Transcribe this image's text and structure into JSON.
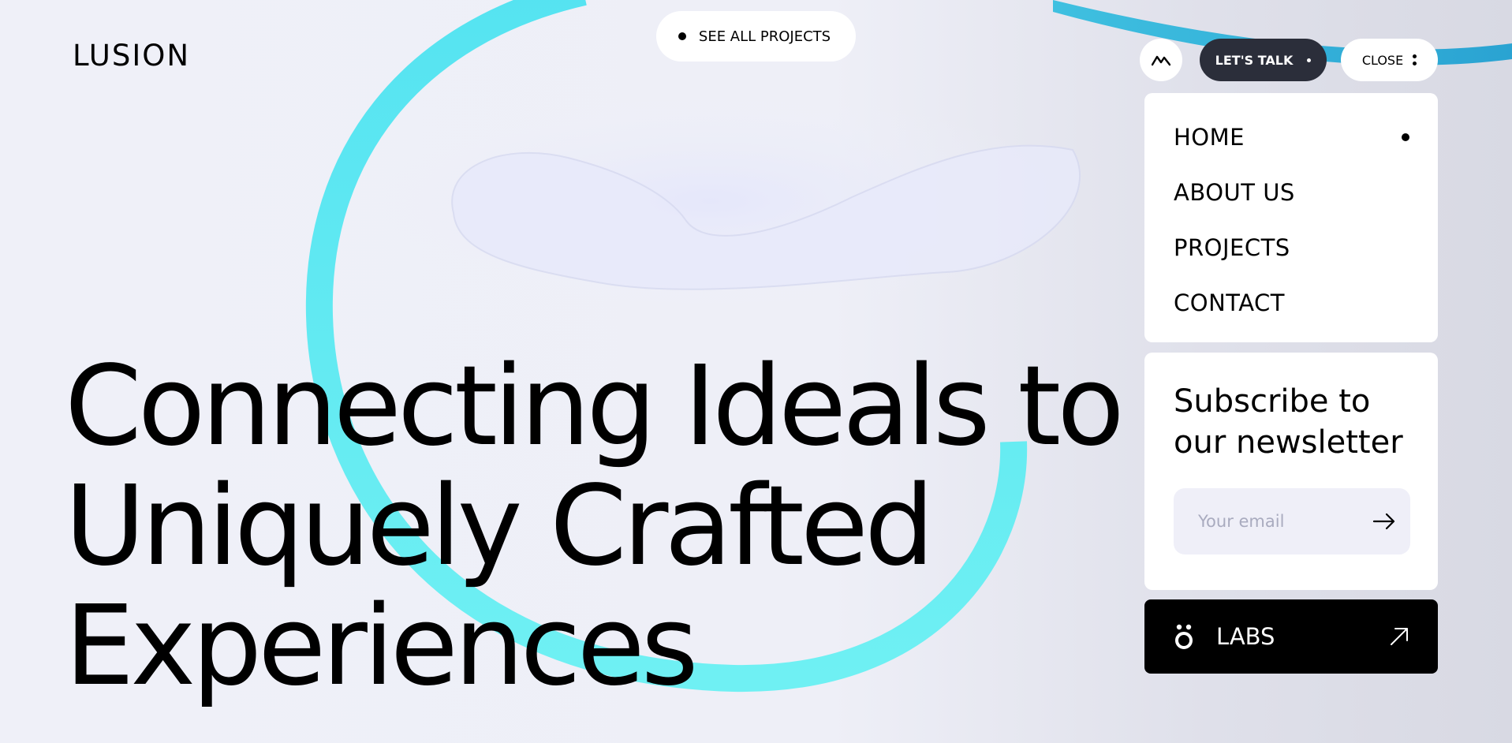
{
  "header": {
    "logo": "LUSION",
    "see_all_label": "SEE ALL PROJECTS",
    "lets_talk_label": "LET'S TALK",
    "close_label": "CLOSE"
  },
  "hero": {
    "lines": [
      "Connecting Ideals to",
      "Uniquely Crafted",
      "Experiences"
    ]
  },
  "menu": {
    "items": [
      {
        "label": "HOME",
        "active": true
      },
      {
        "label": "ABOUT US",
        "active": false
      },
      {
        "label": "PROJECTS",
        "active": false
      },
      {
        "label": "CONTACT",
        "active": false
      }
    ]
  },
  "newsletter": {
    "title": "Subscribe to our newsletter",
    "email_placeholder": "Your email"
  },
  "labs": {
    "label": "LABS"
  },
  "colors": {
    "accent_ribbon": "#4fe6ef",
    "dark_button": "#2b2e3a",
    "labs_bg": "#000000"
  }
}
